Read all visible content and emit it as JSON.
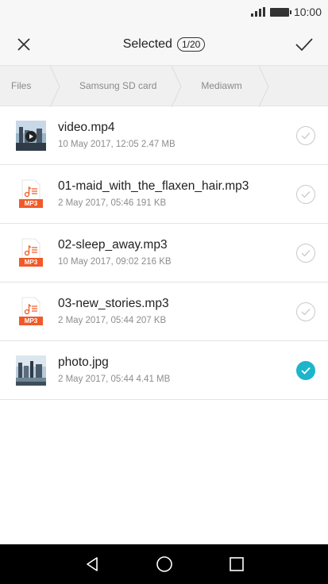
{
  "status_bar": {
    "time": "10:00"
  },
  "header": {
    "title": "Selected",
    "count": "1/20"
  },
  "breadcrumb": [
    "Files",
    "Samsung SD card",
    "Mediawm"
  ],
  "files": [
    {
      "name": "video.mp4",
      "meta": "10 May 2017, 12:05 2.47 MB",
      "type": "video",
      "selected": false
    },
    {
      "name": "01-maid_with_the_flaxen_hair.mp3",
      "meta": "2 May 2017, 05:46 191 KB",
      "type": "audio",
      "tag": "MP3",
      "selected": false
    },
    {
      "name": "02-sleep_away.mp3",
      "meta": "10 May 2017, 09:02 216 KB",
      "type": "audio",
      "tag": "MP3",
      "selected": false
    },
    {
      "name": "03-new_stories.mp3",
      "meta": "2 May 2017, 05:44 207 KB",
      "type": "audio",
      "tag": "MP3",
      "selected": false
    },
    {
      "name": "photo.jpg",
      "meta": "2 May 2017, 05:44 4.41 MB",
      "type": "image",
      "selected": true
    }
  ],
  "colors": {
    "accent": "#1cb5cb",
    "mp3_tag": "#f05a28"
  },
  "nav": [
    "back-icon",
    "home-icon",
    "recents-icon"
  ]
}
